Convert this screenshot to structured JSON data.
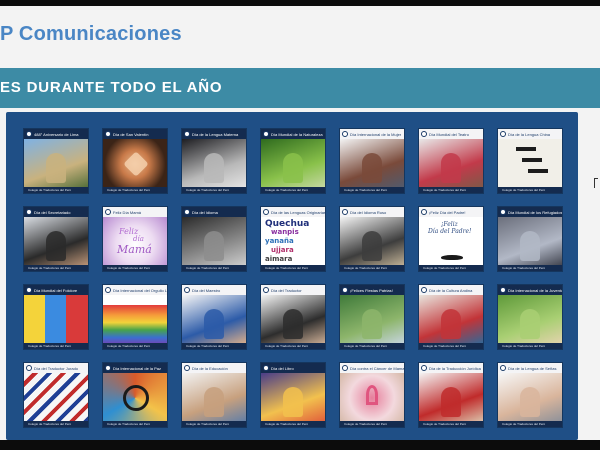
{
  "header": {
    "brand": "P Comunicaciones"
  },
  "section": {
    "title": "ES DURANTE TODO EL AÑO"
  },
  "gallery": {
    "footer_text": "Colegio de Traductores del Perú",
    "tiles": [
      {
        "title": "488° Aniversario de Lima",
        "theme": "lima-cathedral-icon",
        "header_style": "dark",
        "colors": [
          "#7fb2e4",
          "#c9b27e",
          "#4d6b36"
        ]
      },
      {
        "title": "Día de San Valentín",
        "theme": "heart-hands-icon",
        "header_style": "dark",
        "colors": [
          "#3b2417",
          "#c97a49",
          "#e9b88c"
        ]
      },
      {
        "title": "Día de la Lengua Materna",
        "theme": "speech-bubbles-icon",
        "header_style": "dark",
        "colors": [
          "#1e1e22",
          "#b8b8b8",
          "#e7e7e7"
        ]
      },
      {
        "title": "Día Mundial de la Naturaleza",
        "theme": "sprout-icon",
        "header_style": "dark",
        "colors": [
          "#2f6b1e",
          "#89c14a",
          "#c9d9a7"
        ]
      },
      {
        "title": "Día Internacional de la Mujer",
        "theme": "group-of-women-icon",
        "header_style": "light",
        "colors": [
          "#f3f3f3",
          "#7a4a3a",
          "#4f5b6f"
        ]
      },
      {
        "title": "Día Mundial del Teatro",
        "theme": "theatre-masks-icon",
        "header_style": "light",
        "colors": [
          "#e8e8e8",
          "#c23a4a",
          "#7b5a48"
        ]
      },
      {
        "title": "Día de la Lengua China",
        "theme": "calligraphy-icon",
        "header_style": "light",
        "colors": [
          "#f1efe8",
          "#1c1c1c",
          "#8b7a62"
        ]
      },
      {
        "title": "Día del Secretariado",
        "theme": "secretary-icon",
        "header_style": "dark",
        "colors": [
          "#d9dde3",
          "#2a2a2a",
          "#c49a7b"
        ]
      },
      {
        "title": "Feliz Día Mamá",
        "theme": "mothers-day-card-icon",
        "header_style": "light",
        "colors": [
          "#eddcf2",
          "#b78ad0",
          "#ffffff"
        ]
      },
      {
        "title": "Día del Idioma",
        "theme": "library-books-icon",
        "header_style": "dark",
        "colors": [
          "#2b2b2b",
          "#8d8d8d",
          "#d1d1d1"
        ]
      },
      {
        "title": "Día de las Lenguas Originarias",
        "theme": "indigenous-words-icon",
        "header_style": "light",
        "colors": [
          "#ffffff",
          "#2f3f8f",
          "#7a2f8f"
        ]
      },
      {
        "title": "Día del Idioma Ruso",
        "theme": "portrait-icon",
        "header_style": "light",
        "colors": [
          "#f4f4f4",
          "#3d3d3d",
          "#c8b79a"
        ]
      },
      {
        "title": "¡Feliz Día del Padre!",
        "theme": "fathers-day-card-icon",
        "header_style": "light",
        "colors": [
          "#ffffff",
          "#2d4b80",
          "#1a1a1a"
        ]
      },
      {
        "title": "Día Mundial de los Refugiados",
        "theme": "refugees-mural-icon",
        "header_style": "dark",
        "colors": [
          "#6b6f7c",
          "#b2b8c6",
          "#3a3d48"
        ]
      },
      {
        "title": "Día Mundial del Folclore",
        "theme": "folklore-collage-icon",
        "header_style": "dark",
        "colors": [
          "#f4d33a",
          "#3b8be0",
          "#d93a3a"
        ]
      },
      {
        "title": "Día Internacional del Orgullo LGBT",
        "theme": "rainbow-flag-icon",
        "header_style": "light",
        "colors": [
          "#ffffff",
          "#d82e2e",
          "#f2a33a"
        ]
      },
      {
        "title": "Día del Maestro",
        "theme": "classroom-kids-icon",
        "header_style": "light",
        "colors": [
          "#f6f6f6",
          "#2c5ba8",
          "#e2b28a"
        ]
      },
      {
        "title": "Día del Traductor",
        "theme": "teacher-board-icon",
        "header_style": "light",
        "colors": [
          "#f4f4f4",
          "#2d2d2d",
          "#d4b49a"
        ]
      },
      {
        "title": "¡Felices Fiestas Patrias!",
        "theme": "machu-picchu-icon",
        "header_style": "dark",
        "colors": [
          "#3f7a3a",
          "#8db56b",
          "#c9d6e4"
        ]
      },
      {
        "title": "Día de la Cultura Andina",
        "theme": "andean-dancers-icon",
        "header_style": "light",
        "colors": [
          "#e9e5de",
          "#c23438",
          "#2a6a9b"
        ]
      },
      {
        "title": "Día Internacional de la Juventud",
        "theme": "students-park-icon",
        "header_style": "dark",
        "colors": [
          "#5f9a3a",
          "#a9cf73",
          "#e6d3b0"
        ]
      },
      {
        "title": "Día del Traductor Jurado",
        "theme": "world-flags-icon",
        "header_style": "light",
        "colors": [
          "#f6f6f6",
          "#c02b2b",
          "#1f3f95"
        ]
      },
      {
        "title": "Día Internacional de la Paz",
        "theme": "peace-symbol-icon",
        "header_style": "dark",
        "colors": [
          "#d85a2b",
          "#f3c34a",
          "#2f8fd1"
        ]
      },
      {
        "title": "Día de la Educación",
        "theme": "child-reading-icon",
        "header_style": "light",
        "colors": [
          "#f2f2f2",
          "#c7a07e",
          "#5d7da8"
        ]
      },
      {
        "title": "Día del Libro",
        "theme": "books-illustration-icon",
        "header_style": "dark",
        "colors": [
          "#4a3d88",
          "#f2c14e",
          "#e05a3a"
        ]
      },
      {
        "title": "Día contra el Cáncer de Mama",
        "theme": "pink-ribbon-icon",
        "header_style": "light",
        "colors": [
          "#f3d9de",
          "#e67f9c",
          "#d4b8a6"
        ]
      },
      {
        "title": "Día de la Traducción Jurídica",
        "theme": "writing-hand-icon",
        "header_style": "light",
        "colors": [
          "#f4f4f4",
          "#c02b2b",
          "#dcc9b0"
        ]
      },
      {
        "title": "Día de la Lengua de Señas",
        "theme": "sign-language-icon",
        "header_style": "light",
        "colors": [
          "#f7f7f7",
          "#d9b59c",
          "#8a8f99"
        ]
      }
    ]
  },
  "art_text": {
    "mothers_day": {
      "line1": "Feliz",
      "line2": "día",
      "line3": "Mamá"
    },
    "fathers_day": {
      "line1": "¡Feliz",
      "line2": "Día del Padre!"
    },
    "indigenous_words": [
      "Quechua",
      "wanpis",
      "yanaña",
      "ujjara",
      "aimara"
    ]
  },
  "colors": {
    "brand_blue": "#4a86c5",
    "section_bar": "#3d8ba5",
    "gallery_bg": "#1f4f86",
    "tile_header_dark": "#142b4f"
  }
}
